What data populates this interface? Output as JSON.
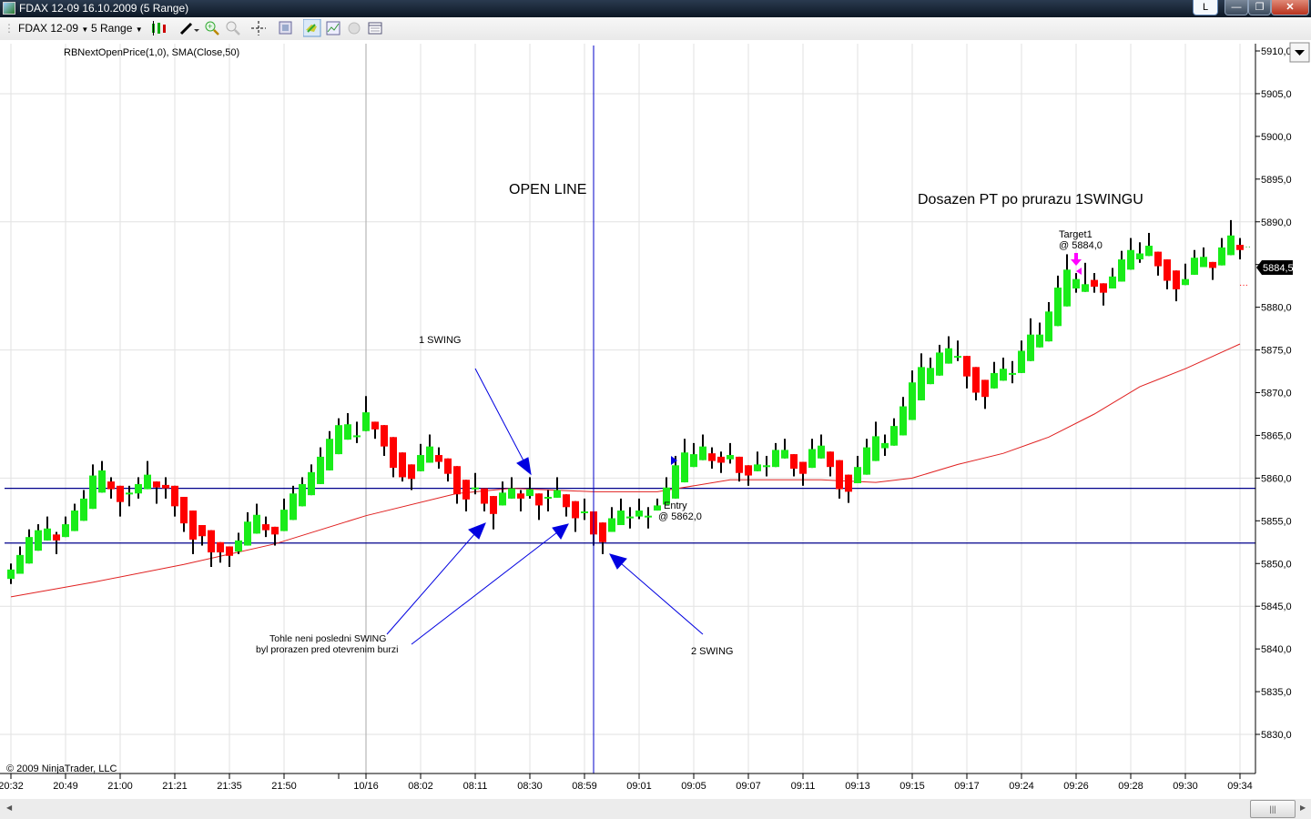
{
  "window": {
    "title": "FDAX 12-09  16.10.2009 (5 Range)",
    "btn_l": "L",
    "btn_min": "—",
    "btn_max": "❐",
    "btn_close": "✕"
  },
  "toolbar": {
    "instrument": "FDAX 12-09",
    "interval": "5 Range",
    "icons": [
      "candlestick-style-icon",
      "drawing-pencil-icon",
      "zoom-in-icon",
      "zoom-out-icon",
      "crosshair-icon",
      "properties-icon",
      "strategy-icon",
      "indicator-icon",
      "record-icon",
      "data-box-icon"
    ]
  },
  "chart_data": {
    "type": "candlestick",
    "title": "",
    "indicator_label": "RBNextOpenPrice(1,0), SMA(Close,50)",
    "copyright": "© 2009 NinjaTrader, LLC",
    "ylim": [
      5826,
      5911
    ],
    "y_ticks": [
      5910,
      5905,
      5900,
      5895,
      5890,
      5885,
      5880,
      5875,
      5870,
      5865,
      5860,
      5855,
      5850,
      5845,
      5840,
      5835,
      5830
    ],
    "y_tick_labels": [
      "5910,0",
      "5905,0",
      "5900,0",
      "5895,0",
      "5890,0",
      "5885,0",
      "5880,0",
      "5875,0",
      "5870,0",
      "5865,0",
      "5860,0",
      "5855,0",
      "5850,0",
      "5845,0",
      "5840,0",
      "5835,0",
      "5830,0"
    ],
    "y_grid": [
      5905,
      5890,
      5875,
      5860,
      5845,
      5830
    ],
    "x_tick_labels": [
      {
        "bar": 1,
        "label": "20:32"
      },
      {
        "bar": 7,
        "label": "20:49"
      },
      {
        "bar": 13,
        "label": "21:00"
      },
      {
        "bar": 19,
        "label": "21:21"
      },
      {
        "bar": 25,
        "label": "21:35"
      },
      {
        "bar": 31,
        "label": "21:50"
      },
      {
        "bar": 37,
        "label": ""
      },
      {
        "bar": 40,
        "label": "10/16"
      },
      {
        "bar": 46,
        "label": "08:02"
      },
      {
        "bar": 52,
        "label": "08:11"
      },
      {
        "bar": 58,
        "label": "08:30"
      },
      {
        "bar": 64,
        "label": "08:59"
      },
      {
        "bar": 70,
        "label": "09:01"
      },
      {
        "bar": 76,
        "label": "09:05"
      },
      {
        "bar": 82,
        "label": "09:07"
      },
      {
        "bar": 88,
        "label": "09:11"
      },
      {
        "bar": 94,
        "label": "09:13"
      },
      {
        "bar": 100,
        "label": "09:15"
      },
      {
        "bar": 106,
        "label": "09:17"
      },
      {
        "bar": 112,
        "label": "09:24"
      },
      {
        "bar": 118,
        "label": "09:26"
      },
      {
        "bar": 124,
        "label": "09:28"
      },
      {
        "bar": 130,
        "label": "09:30"
      },
      {
        "bar": 136,
        "label": "09:34"
      }
    ],
    "day_separator_bar": 40,
    "bars_ohlc": [
      [
        5848.2,
        5850,
        5847.6,
        5849.3
      ],
      [
        5848.8,
        5852,
        5848.8,
        5851
      ],
      [
        5850,
        5854,
        5850,
        5853.1
      ],
      [
        5851.5,
        5854.6,
        5851.5,
        5853.9
      ],
      [
        5852.7,
        5855.5,
        5852.7,
        5854.1
      ],
      [
        5853.4,
        5853.7,
        5851.1,
        5852.7
      ],
      [
        5853.1,
        5855.5,
        5853.1,
        5854.6
      ],
      [
        5853.8,
        5857,
        5853.8,
        5856.2
      ],
      [
        5855,
        5858.6,
        5855,
        5857.6
      ],
      [
        5856.4,
        5861.6,
        5856.4,
        5860.3
      ],
      [
        5858.3,
        5862,
        5858.3,
        5860.9
      ],
      [
        5859.6,
        5860.1,
        5857.6,
        5858.7
      ],
      [
        5859.1,
        5859.1,
        5855.5,
        5857.2
      ],
      [
        5858.2,
        5859.1,
        5856.7,
        5858.3
      ],
      [
        5858.2,
        5860.1,
        5857.6,
        5859.3
      ],
      [
        5858.7,
        5862,
        5858.7,
        5860.4
      ],
      [
        5859.6,
        5859.6,
        5857,
        5858.9
      ],
      [
        5859.2,
        5860.1,
        5857.6,
        5858.8
      ],
      [
        5859.1,
        5859.1,
        5855.5,
        5856.7
      ],
      [
        5857.8,
        5857.8,
        5853.7,
        5854.7
      ],
      [
        5856.2,
        5856.2,
        5851.1,
        5852.8
      ],
      [
        5854.5,
        5854.5,
        5852.1,
        5853.2
      ],
      [
        5853.9,
        5853.9,
        5849.6,
        5851.3
      ],
      [
        5852.5,
        5852.5,
        5850.1,
        5851.3
      ],
      [
        5852,
        5852,
        5849.6,
        5850.9
      ],
      [
        5851.4,
        5853.6,
        5851.1,
        5852.7
      ],
      [
        5852.1,
        5856,
        5852.1,
        5854.9
      ],
      [
        5853.5,
        5857,
        5853.5,
        5855.7
      ],
      [
        5854.6,
        5855.5,
        5853.1,
        5853.9
      ],
      [
        5854.3,
        5854.3,
        5852.1,
        5853.4
      ],
      [
        5853.8,
        5857.6,
        5853.8,
        5856.3
      ],
      [
        5855.1,
        5859.1,
        5855.1,
        5858.2
      ],
      [
        5856.7,
        5860.1,
        5856.7,
        5859.3
      ],
      [
        5858,
        5861.6,
        5858,
        5860.7
      ],
      [
        5859.3,
        5863.6,
        5859.3,
        5862.5
      ],
      [
        5860.9,
        5865.5,
        5860.9,
        5864.6
      ],
      [
        5862.8,
        5867,
        5862.8,
        5866.2
      ],
      [
        5864.5,
        5867.6,
        5864.5,
        5866.3
      ],
      [
        5865,
        5866.6,
        5864.1,
        5865
      ],
      [
        5865.5,
        5869.6,
        5865.5,
        5867.7
      ],
      [
        5866.6,
        5866.6,
        5864.6,
        5865.7
      ],
      [
        5866.2,
        5866.2,
        5862.6,
        5863.7
      ],
      [
        5864.8,
        5864.8,
        5860.1,
        5861.2
      ],
      [
        5863,
        5863,
        5859.6,
        5860.1
      ],
      [
        5861.6,
        5861.6,
        5858.6,
        5859.9
      ],
      [
        5860.8,
        5864,
        5860.8,
        5862.7
      ],
      [
        5861.8,
        5865.1,
        5861.8,
        5863.7
      ],
      [
        5862.7,
        5863.6,
        5861.1,
        5861.9
      ],
      [
        5862.3,
        5862.3,
        5859.6,
        5860.5
      ],
      [
        5861.4,
        5861.4,
        5857,
        5858.1
      ],
      [
        5859.8,
        5859.8,
        5856.1,
        5857.5
      ],
      [
        5858.9,
        5860.6,
        5858.1,
        5858.9
      ],
      [
        5858.8,
        5858.8,
        5856.1,
        5857
      ],
      [
        5857.9,
        5857.9,
        5854,
        5855.8
      ],
      [
        5856.8,
        5859.6,
        5856.8,
        5858.3
      ],
      [
        5857.6,
        5860.1,
        5857.6,
        5858.8
      ],
      [
        5858.2,
        5858.6,
        5856.1,
        5857.6
      ],
      [
        5857.9,
        5860.1,
        5857.6,
        5858.7
      ],
      [
        5858.2,
        5858.2,
        5855.1,
        5856.8
      ],
      [
        5857.8,
        5858.6,
        5856.1,
        5857.8
      ],
      [
        5857.7,
        5860.1,
        5857.7,
        5858.6
      ],
      [
        5858.1,
        5858.1,
        5855.5,
        5856.6
      ],
      [
        5857.3,
        5857.3,
        5853.7,
        5855.3
      ],
      [
        5856.1,
        5857.6,
        5855.1,
        5856.1
      ],
      [
        5856.1,
        5856.1,
        5852.1,
        5853.4
      ],
      [
        5854.8,
        5854.8,
        5851.1,
        5852.5
      ],
      [
        5853.7,
        5856.6,
        5853.7,
        5855.3
      ],
      [
        5854.5,
        5857.6,
        5854.5,
        5856.2
      ],
      [
        5855.5,
        5856.6,
        5854.1,
        5855.5
      ],
      [
        5855.5,
        5857.6,
        5855.2,
        5856.2
      ],
      [
        5855.6,
        5856.6,
        5854.1,
        5855.6
      ],
      [
        5856.2,
        5857.6,
        5856.2,
        5856.8
      ],
      [
        5856.9,
        5860.1,
        5856.9,
        5858.9
      ],
      [
        5857.6,
        5862.6,
        5857.6,
        5861.5
      ],
      [
        5859.5,
        5864.6,
        5859.5,
        5863
      ],
      [
        5861.3,
        5864.1,
        5861.3,
        5862.8
      ],
      [
        5862.1,
        5865.1,
        5862.1,
        5863.7
      ],
      [
        5862.9,
        5863.6,
        5861.1,
        5862
      ],
      [
        5862.5,
        5863.1,
        5860.6,
        5861.8
      ],
      [
        5862.2,
        5864.1,
        5861.7,
        5862.7
      ],
      [
        5862.5,
        5862.5,
        5859.6,
        5860.6
      ],
      [
        5861.5,
        5861.5,
        5859.1,
        5860.3
      ],
      [
        5860.8,
        5863.1,
        5860.8,
        5861.6
      ],
      [
        5861.5,
        5862.6,
        5860.2,
        5861.5
      ],
      [
        5861.3,
        5864.1,
        5861.3,
        5863.3
      ],
      [
        5862.3,
        5864.6,
        5862.3,
        5863.3
      ],
      [
        5862.8,
        5862.8,
        5860.2,
        5861.1
      ],
      [
        5861.9,
        5861.9,
        5859.1,
        5860.5
      ],
      [
        5861.2,
        5864.6,
        5861.2,
        5863.4
      ],
      [
        5862.3,
        5865.1,
        5862.3,
        5863.8
      ],
      [
        5863.1,
        5863.1,
        5860.2,
        5861.3
      ],
      [
        5862.1,
        5862.1,
        5857.6,
        5858.7
      ],
      [
        5860.4,
        5860.4,
        5857.1,
        5858.4
      ],
      [
        5859.4,
        5862.6,
        5859.4,
        5861.3
      ],
      [
        5860.4,
        5864.6,
        5860.4,
        5863.6
      ],
      [
        5862,
        5866.6,
        5862,
        5864.9
      ],
      [
        5863.5,
        5865.1,
        5862.6,
        5864.1
      ],
      [
        5863.8,
        5867,
        5863.8,
        5866.1
      ],
      [
        5865,
        5869.5,
        5865,
        5868.4
      ],
      [
        5866.8,
        5872.6,
        5866.8,
        5871.2
      ],
      [
        5869.1,
        5874.6,
        5869.1,
        5873
      ],
      [
        5871,
        5874.1,
        5871,
        5872.9
      ],
      [
        5872,
        5875.6,
        5872,
        5874.7
      ],
      [
        5873.4,
        5876.6,
        5873.4,
        5875.2
      ],
      [
        5874.3,
        5876.1,
        5873.7,
        5874.3
      ],
      [
        5874.3,
        5874.3,
        5870.5,
        5871.9
      ],
      [
        5873,
        5873,
        5869.1,
        5870
      ],
      [
        5871.5,
        5871.5,
        5868.1,
        5869.5
      ],
      [
        5870.5,
        5873.6,
        5870.5,
        5872.3
      ],
      [
        5871.4,
        5874.1,
        5871.4,
        5872.8
      ],
      [
        5872.3,
        5873.7,
        5871.1,
        5872.3
      ],
      [
        5872.3,
        5876.1,
        5872.3,
        5874.9
      ],
      [
        5873.7,
        5878.7,
        5873.7,
        5876.8
      ],
      [
        5875.3,
        5878.2,
        5875.3,
        5876.8
      ],
      [
        5876,
        5880.6,
        5876,
        5879.5
      ],
      [
        5877.8,
        5883.7,
        5877.8,
        5882.3
      ],
      [
        5880.1,
        5886.2,
        5880.1,
        5884.4
      ],
      [
        5882.2,
        5884,
        5881.7,
        5883.3
      ],
      [
        5881.8,
        5885.2,
        5881.8,
        5882.7
      ],
      [
        5883.2,
        5884,
        5881.7,
        5882.4
      ],
      [
        5882.8,
        5882.8,
        5880.2,
        5881.7
      ],
      [
        5882.2,
        5884.6,
        5882.2,
        5883.6
      ],
      [
        5883,
        5886.6,
        5883,
        5885.6
      ],
      [
        5884.4,
        5888.1,
        5884.4,
        5886.7
      ],
      [
        5885.6,
        5887.6,
        5885.2,
        5886.3
      ],
      [
        5886,
        5888.7,
        5886,
        5887.2
      ],
      [
        5886.5,
        5886.5,
        5883.7,
        5884.8
      ],
      [
        5885.6,
        5885.6,
        5882.1,
        5883.1
      ],
      [
        5884.3,
        5884.3,
        5880.7,
        5882.1
      ],
      [
        5882.6,
        5885.1,
        5882.6,
        5883.3
      ],
      [
        5883.8,
        5886.7,
        5883.8,
        5885.8
      ],
      [
        5884.7,
        5887,
        5884.7,
        5885.9
      ],
      [
        5885.3,
        5885.3,
        5883.2,
        5884.6
      ],
      [
        5884.9,
        5888.1,
        5884.9,
        5887
      ],
      [
        5886.1,
        5890.2,
        5886.1,
        5888.4
      ],
      [
        5887.3,
        5888.1,
        5885.6,
        5886.7
      ]
    ],
    "sma_50": [
      [
        1,
        5846.1
      ],
      [
        10,
        5847.8
      ],
      [
        20,
        5849.9
      ],
      [
        30,
        5852.3
      ],
      [
        40,
        5855.6
      ],
      [
        50,
        5858.2
      ],
      [
        56,
        5858.8
      ],
      [
        65,
        5858.4
      ],
      [
        72,
        5858.4
      ],
      [
        80,
        5859.8
      ],
      [
        90,
        5859.8
      ],
      [
        96,
        5859.5
      ],
      [
        100,
        5860
      ],
      [
        105,
        5861.6
      ],
      [
        110,
        5862.9
      ],
      [
        115,
        5864.8
      ],
      [
        120,
        5867.5
      ],
      [
        125,
        5870.7
      ],
      [
        130,
        5872.8
      ],
      [
        136,
        5875.7
      ]
    ],
    "horizontal_lines": [
      5858.8,
      5852.4
    ],
    "open_line_bar": 65,
    "last_price_label": "5884,5",
    "entry_bar": 74,
    "target_bar": 118,
    "annotations": {
      "open_line": "OPEN LINE",
      "pt_reached": "Dosazen PT po prurazu 1SWINGU",
      "swing1": "1 SWING",
      "swing2": "2 SWING",
      "not_last_1": "Tohle neni posledni SWING",
      "not_last_2": "byl prorazen pred otevrenim burzi",
      "entry_1": "Entry",
      "entry_2": "@ 5862,0",
      "target_1": "Target1",
      "target_2": "@ 5884,0"
    },
    "colors": {
      "up": "#19ec19",
      "down": "#ff0000",
      "wick": "#000000",
      "sma": "#e02020",
      "lines": "#00008b",
      "marker": "#ff00ff"
    }
  }
}
